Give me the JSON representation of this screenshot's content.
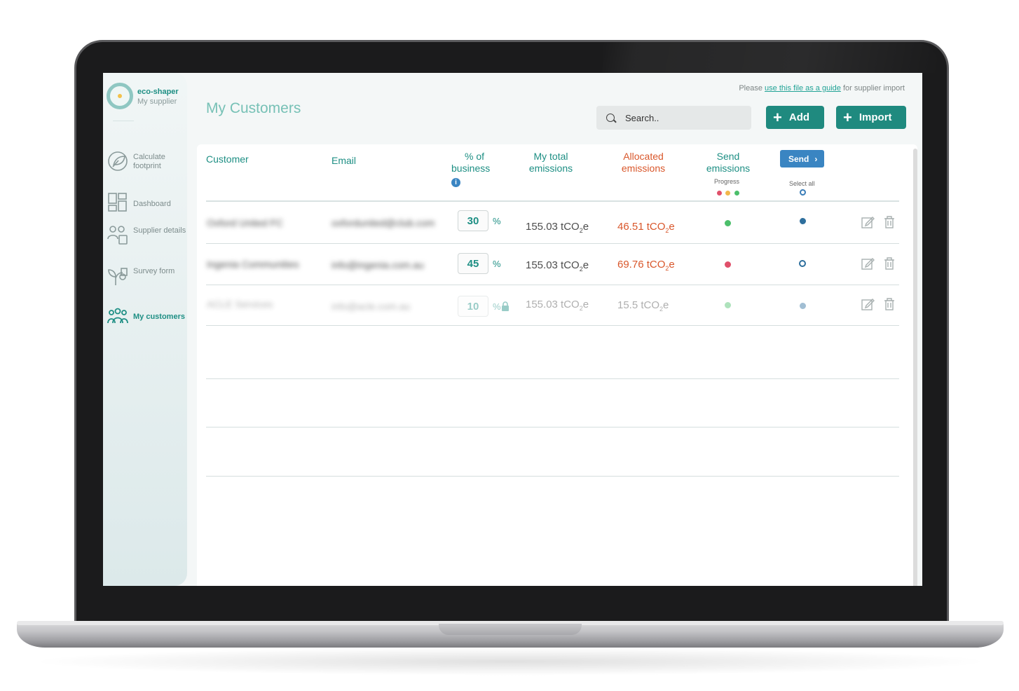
{
  "app": {
    "brand_name": "eco-shaper",
    "brand_sub": "My supplier"
  },
  "sidebar": {
    "items": [
      {
        "label": "Calculate footprint",
        "icon": "leaf-circle-icon"
      },
      {
        "label": "Dashboard",
        "icon": "dashboard-grid-icon"
      },
      {
        "label": "Supplier details",
        "icon": "supplier-people-icon"
      },
      {
        "label": "Survey form",
        "icon": "survey-plant-icon"
      },
      {
        "label": "My customers",
        "icon": "customers-group-icon",
        "active": true
      }
    ]
  },
  "header": {
    "title": "My Customers",
    "hint_prefix": "Please",
    "hint_link": "use this file as a guide",
    "hint_suffix": "for supplier import",
    "search_placeholder": "Search..",
    "add_label": "Add",
    "import_label": "Import"
  },
  "table": {
    "columns": {
      "customer": "Customer",
      "email": "Email",
      "pct_line1": "% of",
      "pct_line2": "business",
      "total_line1": "My total",
      "total_line2": "emissions",
      "alloc_line1": "Allocated",
      "alloc_line2": "emissions",
      "send_line1": "Send",
      "send_line2": "emissions",
      "progress": "Progress",
      "send_button": "Send",
      "select_all": "Select all"
    },
    "rows": [
      {
        "customer": "Oxford United FC",
        "email": "oxfordunited@club.com",
        "pct": "30",
        "pct_sign": "%",
        "total": "155.03 tCO",
        "total_unit": "e",
        "allocated": "46.51 tCO",
        "allocated_unit": "e",
        "status_color": "#4cbf6b",
        "selected": true,
        "locked": false
      },
      {
        "customer": "Ingenia Communities",
        "email": "info@ingenia.com.au",
        "pct": "45",
        "pct_sign": "%",
        "total": "155.03 tCO",
        "total_unit": "e",
        "allocated": "69.76 tCO",
        "allocated_unit": "e",
        "status_color": "#e0506a",
        "selected": false,
        "locked": false
      },
      {
        "customer": "ACLE Services",
        "email": "info@acle.com.au",
        "pct": "10",
        "pct_sign": "%",
        "total": "155.03 tCO",
        "total_unit": "e",
        "allocated": "15.5 tCO",
        "allocated_unit": "e",
        "status_color": "#4cbf6b",
        "selected": true,
        "locked": true
      }
    ],
    "subscript": "2"
  },
  "colors": {
    "teal": "#1e8f84",
    "orange": "#d9572b",
    "blue": "#3a85c2",
    "progress_red": "#e0506a",
    "progress_amber": "#f2b84b",
    "progress_green": "#4cbf6b"
  }
}
